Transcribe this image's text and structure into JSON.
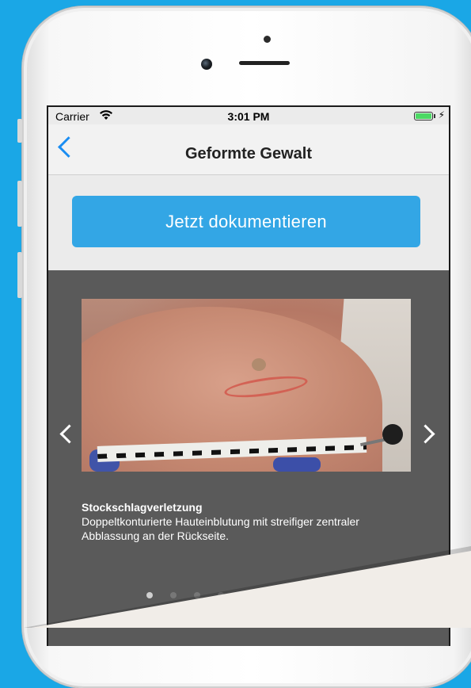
{
  "status_bar": {
    "carrier": "Carrier",
    "time": "3:01 PM",
    "wifi_icon": "wifi-icon",
    "battery_icon": "battery-icon",
    "battery_color": "#4cd964"
  },
  "nav": {
    "title": "Geformte Gewalt",
    "back_icon": "chevron-left-icon",
    "accent": "#1a8df2"
  },
  "cta": {
    "label": "Jetzt dokumentieren",
    "color": "#33a6e5"
  },
  "gallery": {
    "caption_title": "Stockschlagverletzung",
    "caption_text": "Doppeltkonturierte Hauteinblutung mit streifiger zentraler Abblassung an der Rückseite.",
    "prev_icon": "chevron-left-icon",
    "next_icon": "chevron-right-icon",
    "page_count": 4,
    "active_page": 1
  }
}
